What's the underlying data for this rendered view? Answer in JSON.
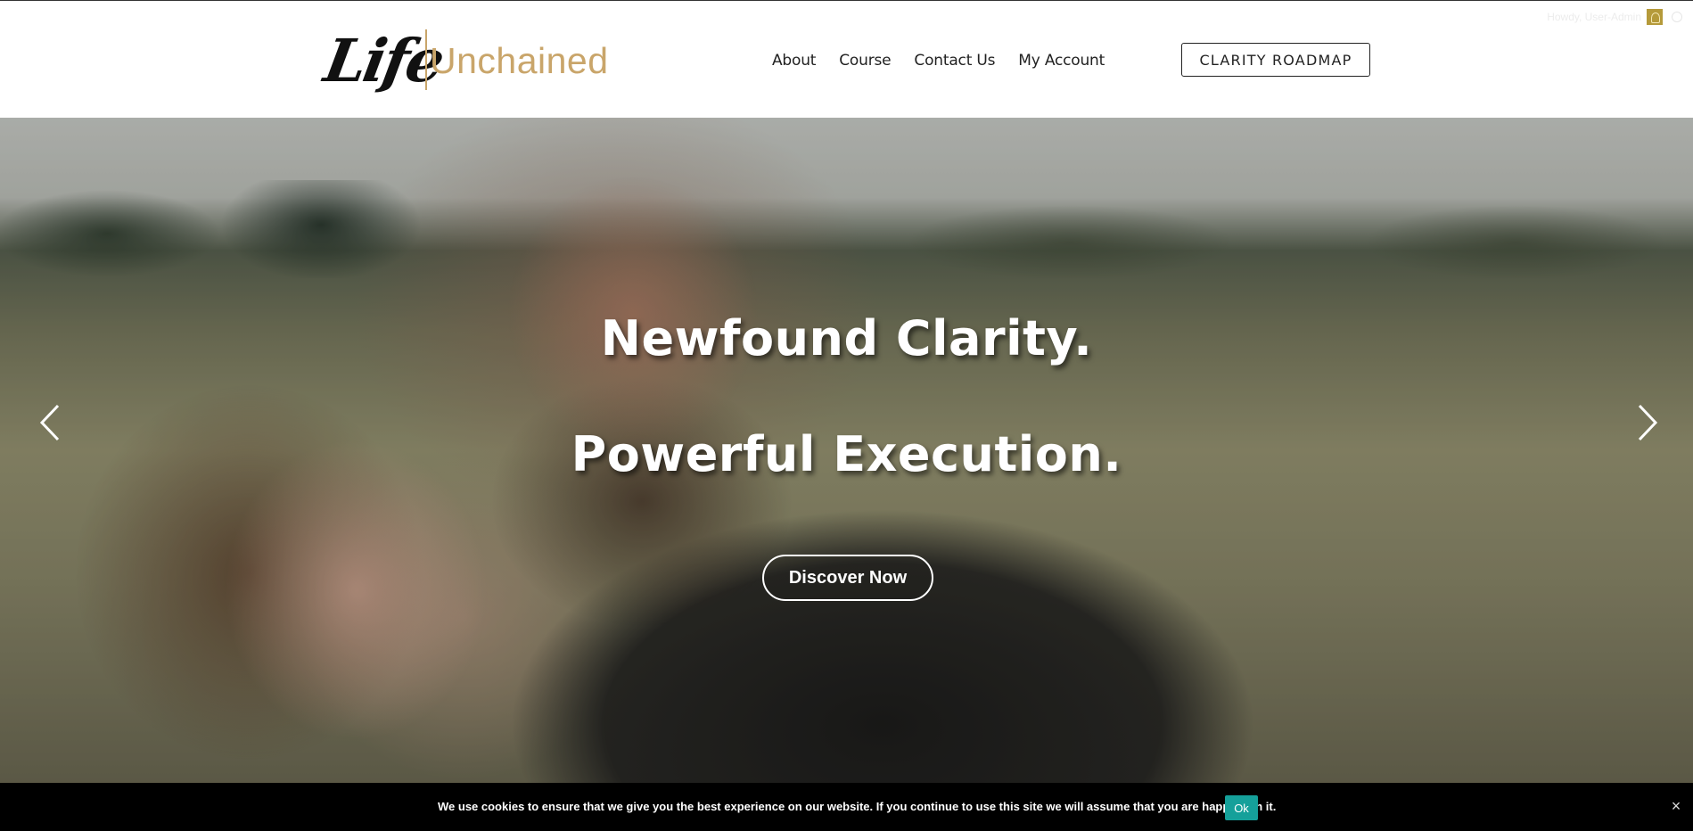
{
  "admin_bar": {
    "greeting": "Howdy, User-Admin"
  },
  "logo": {
    "script_text": "Life",
    "word_text": "Unchained"
  },
  "nav": {
    "items": [
      {
        "label": "About"
      },
      {
        "label": "Course"
      },
      {
        "label": "Contact Us"
      },
      {
        "label": "My Account"
      }
    ],
    "cta_label": "CLARITY ROADMAP"
  },
  "hero": {
    "line1": "Newfound Clarity.",
    "line2": "Powerful Execution.",
    "button_label": "Discover Now",
    "prev_icon": "chevron-left-icon",
    "next_icon": "chevron-right-icon"
  },
  "cookie_bar": {
    "message": "We use cookies to ensure that we give you the best experience on our website. If you continue to use this site we will assume that you are happy with it.",
    "ok_label": "Ok",
    "close_label": "×"
  },
  "colors": {
    "brand_gold": "#c9a56a",
    "cookie_ok": "#15a09a",
    "text_dark": "#222222"
  }
}
